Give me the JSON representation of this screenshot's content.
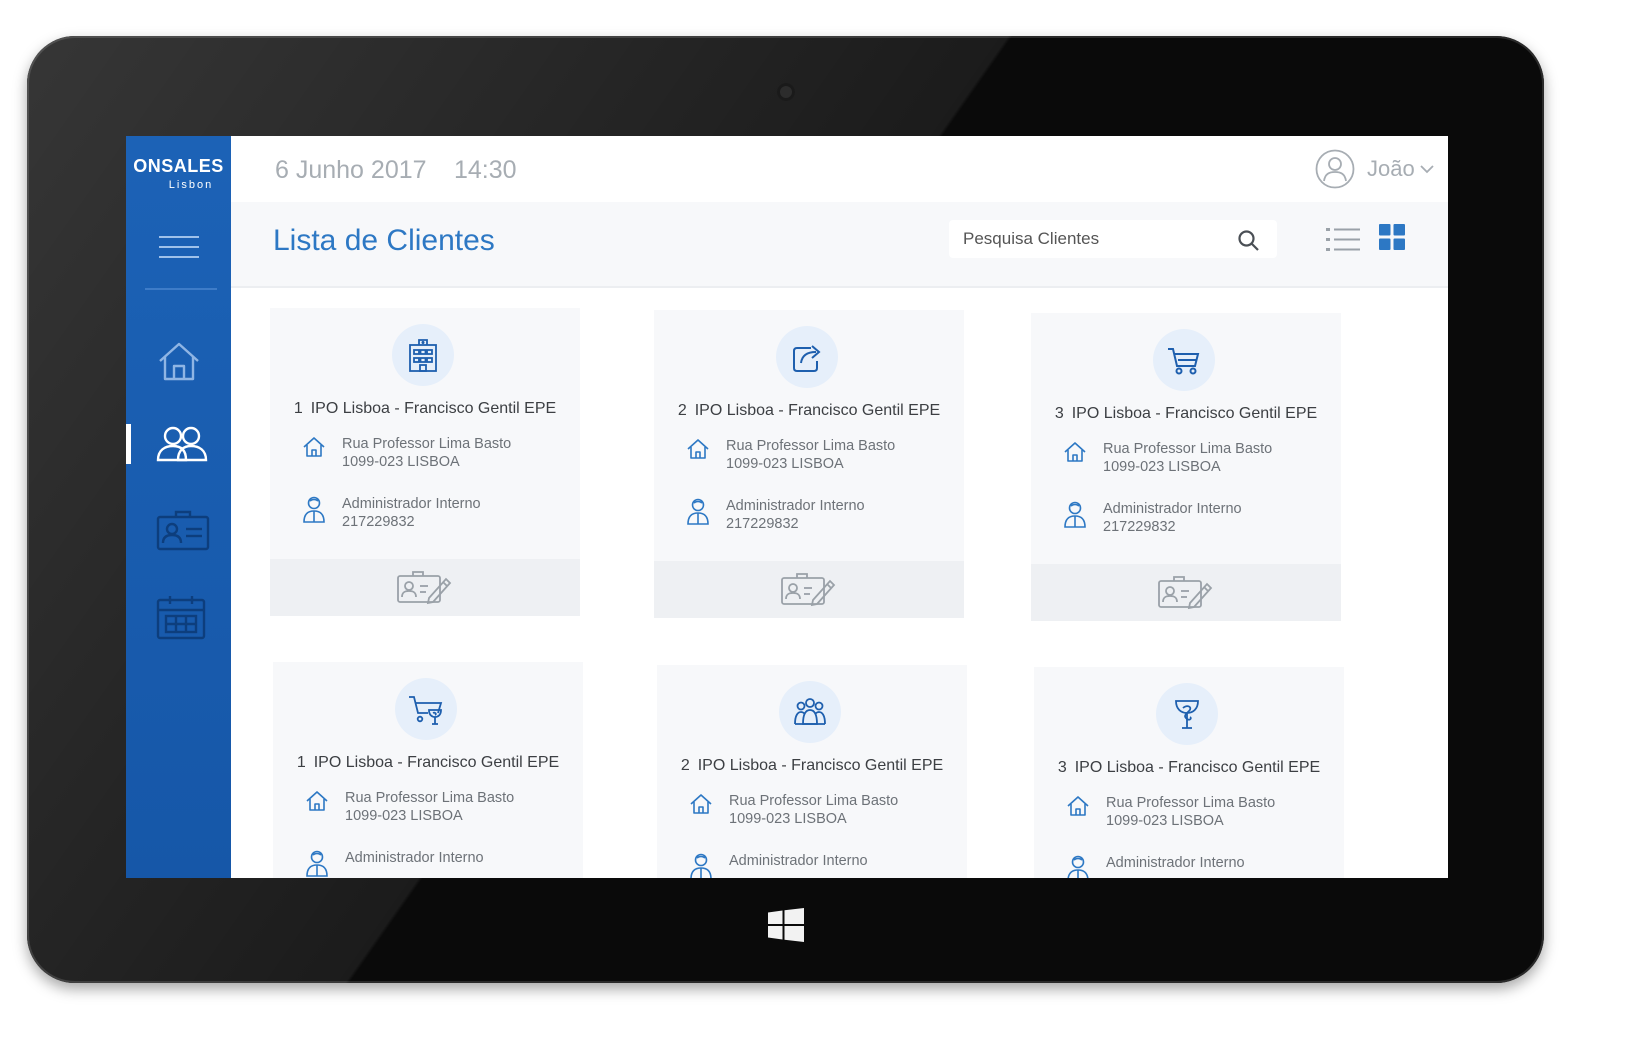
{
  "app": {
    "brand": "ONSALES",
    "city": "Lisbon"
  },
  "topbar": {
    "date": "6 Junho 2017",
    "time": "14:30",
    "user": "João"
  },
  "header": {
    "title": "Lista de Clientes",
    "search_placeholder": "Pesquisa Clientes"
  },
  "nav": [
    {
      "icon": "home-icon"
    },
    {
      "icon": "clients-icon",
      "active": true
    },
    {
      "icon": "contact-card-icon"
    },
    {
      "icon": "calendar-icon"
    }
  ],
  "colors": {
    "sidebar": "#1c62b6",
    "accent": "#2d78c4",
    "card_bg": "#f7f8fa",
    "icon_bg": "#e6effa"
  },
  "clients": [
    {
      "number": "1",
      "name": "IPO Lisboa - Francisco Gentil EPE",
      "icon": "hospital-icon",
      "street": "Rua Professor Lima Basto",
      "postal": "1099-023 LISBOA",
      "contact_role": "Administrador Interno",
      "phone": "217229832"
    },
    {
      "number": "2",
      "name": "IPO Lisboa - Francisco Gentil EPE",
      "icon": "share-icon",
      "street": "Rua Professor Lima Basto",
      "postal": "1099-023 LISBOA",
      "contact_role": "Administrador Interno",
      "phone": "217229832"
    },
    {
      "number": "3",
      "name": "IPO Lisboa - Francisco Gentil EPE",
      "icon": "cart-icon",
      "street": "Rua Professor Lima Basto",
      "postal": "1099-023 LISBOA",
      "contact_role": "Administrador Interno",
      "phone": "217229832"
    },
    {
      "number": "1",
      "name": "IPO Lisboa - Francisco Gentil EPE",
      "icon": "pharmacy-cart-icon",
      "street": "Rua Professor Lima Basto",
      "postal": "1099-023 LISBOA",
      "contact_role": "Administrador Interno",
      "phone": ""
    },
    {
      "number": "2",
      "name": "IPO Lisboa - Francisco Gentil EPE",
      "icon": "group-icon",
      "street": "Rua Professor Lima Basto",
      "postal": "1099-023 LISBOA",
      "contact_role": "Administrador Interno",
      "phone": ""
    },
    {
      "number": "3",
      "name": "IPO Lisboa - Francisco Gentil EPE",
      "icon": "pharmacy-icon",
      "street": "Rua Professor Lima Basto",
      "postal": "1099-023 LISBOA",
      "contact_role": "Administrador Interno",
      "phone": ""
    }
  ]
}
